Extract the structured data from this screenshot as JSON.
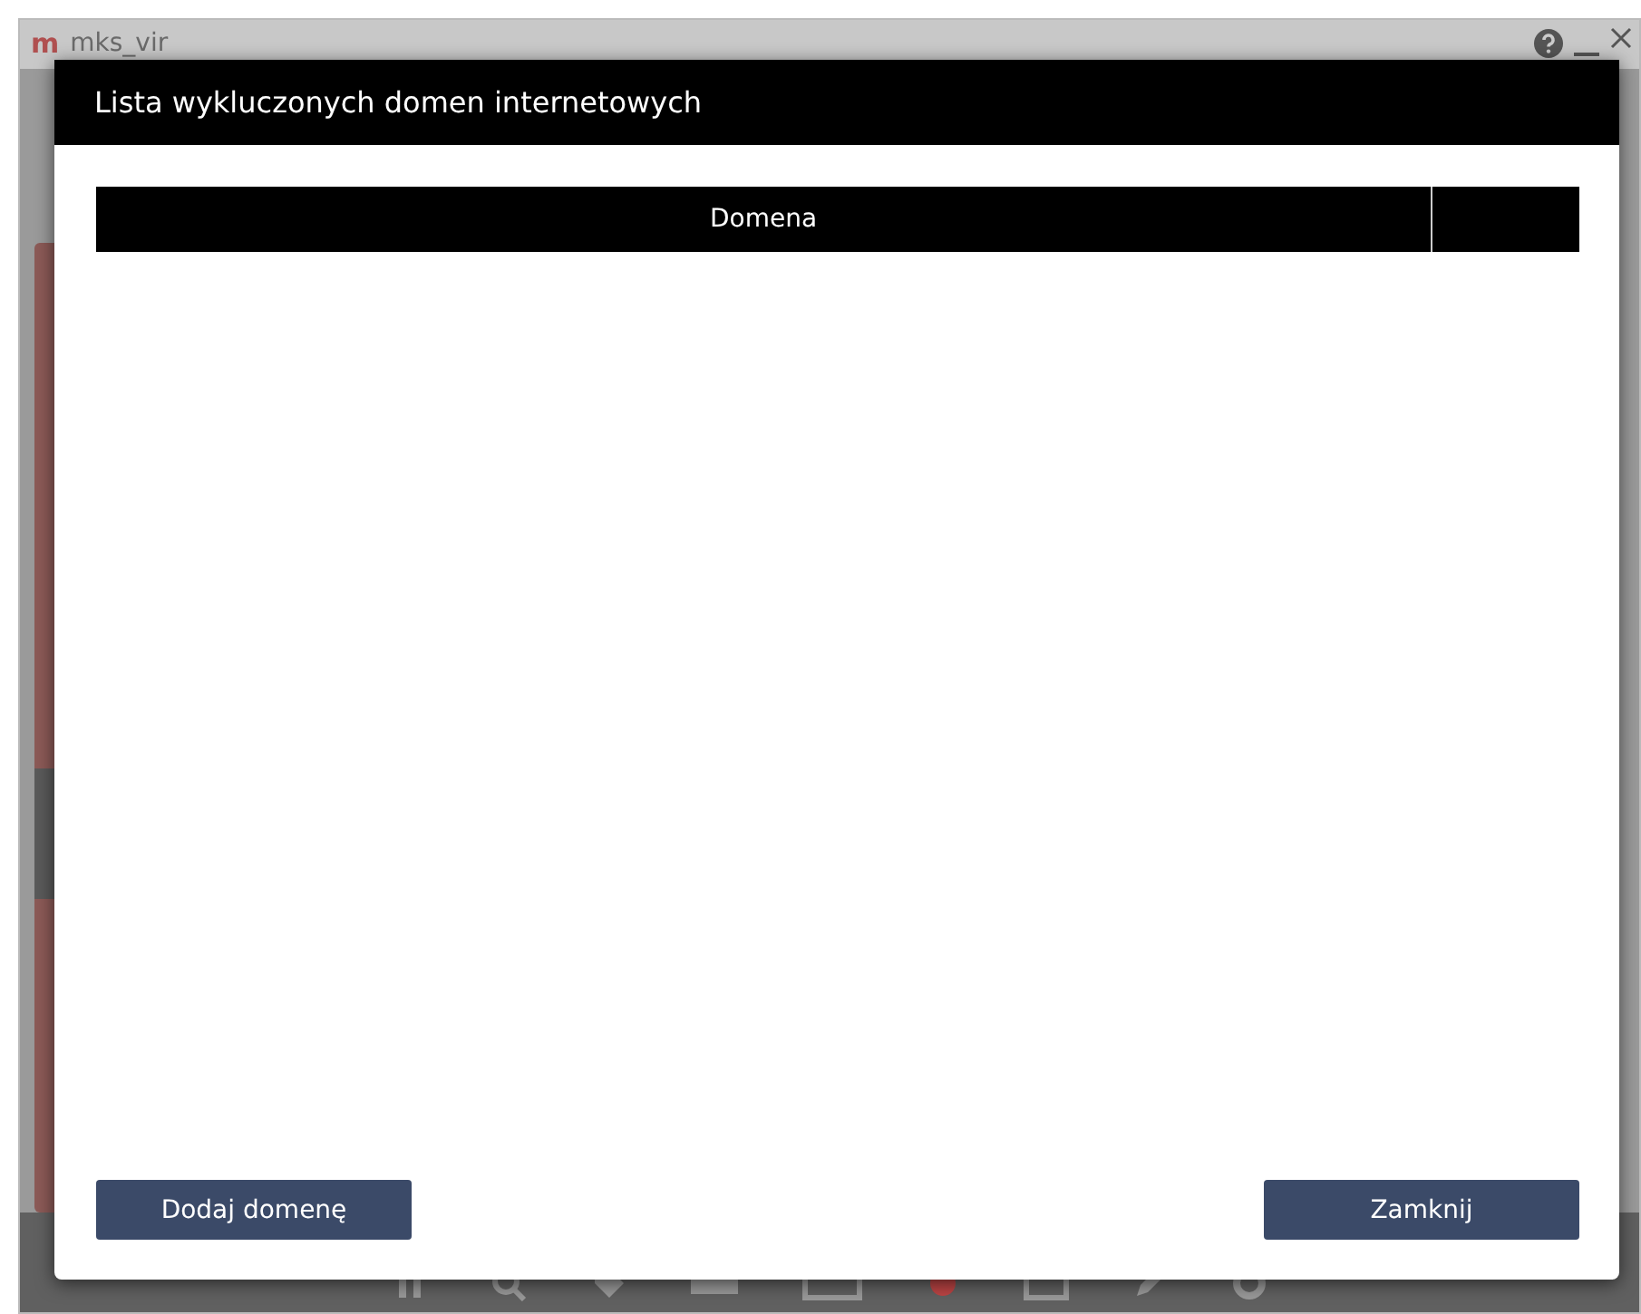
{
  "background_window": {
    "logo": "m",
    "title": "mks_vir"
  },
  "dialog": {
    "title": "Lista wykluczonych domen internetowych",
    "table": {
      "columns": [
        "Domena"
      ]
    },
    "buttons": [
      "Dodaj domenę",
      "Zamknij"
    ]
  }
}
